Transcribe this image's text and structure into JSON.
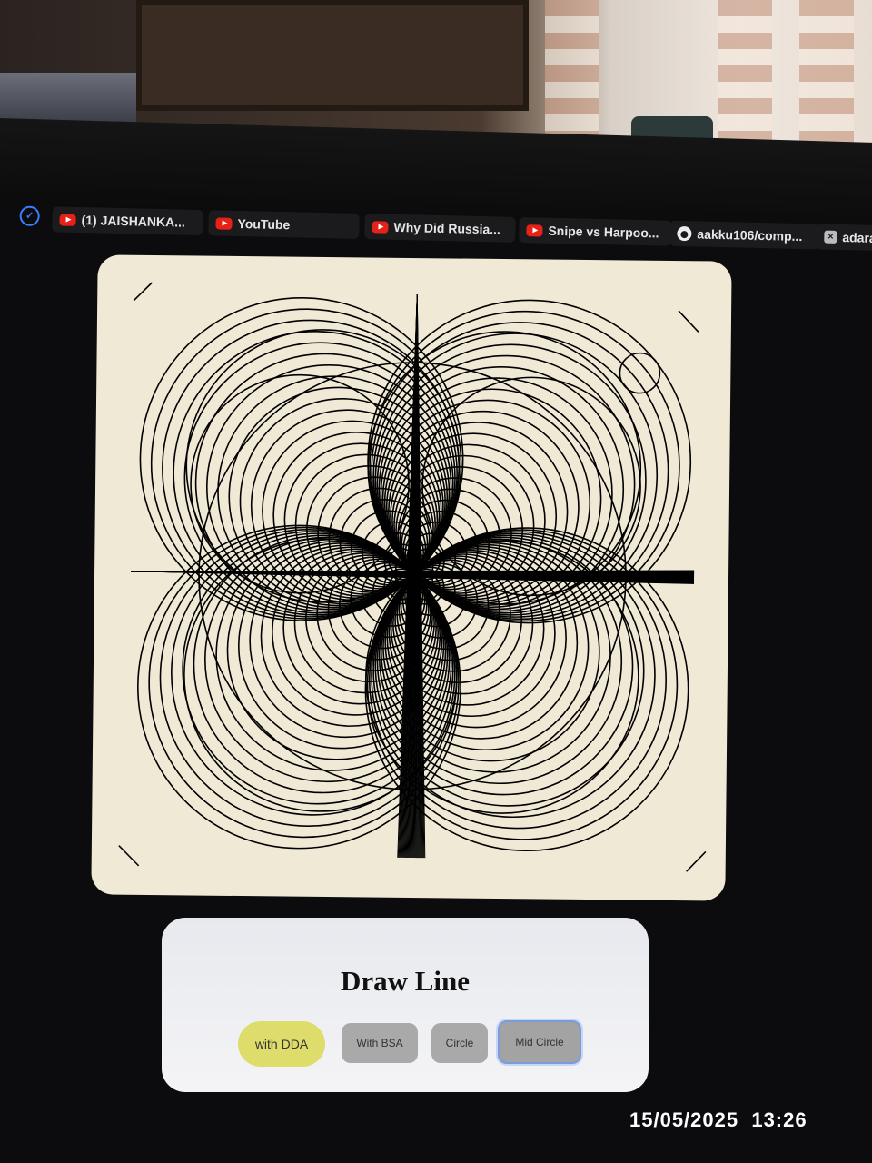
{
  "browser": {
    "tabs": [
      {
        "icon": "youtube-icon",
        "label": "(1) JAISHANKA..."
      },
      {
        "icon": "youtube-icon",
        "label": "YouTube"
      },
      {
        "icon": "youtube-icon",
        "label": "Why Did Russia..."
      },
      {
        "icon": "youtube-icon",
        "label": "Snipe vs Harpoo..."
      },
      {
        "icon": "github-icon",
        "label": "aakku106/comp..."
      },
      {
        "icon": "close-box-icon",
        "label": "adara"
      }
    ]
  },
  "canvas": {
    "background": "#f0e9d6",
    "stroke": "#000000"
  },
  "panel": {
    "title": "Draw Line",
    "buttons": {
      "dda": "with DDA",
      "bsa": "With BSA",
      "circle": "Circle",
      "mid_circle": "Mid Circle"
    },
    "accent": "#dedc6a"
  },
  "photo_timestamp": "15/05/2025  13:26"
}
